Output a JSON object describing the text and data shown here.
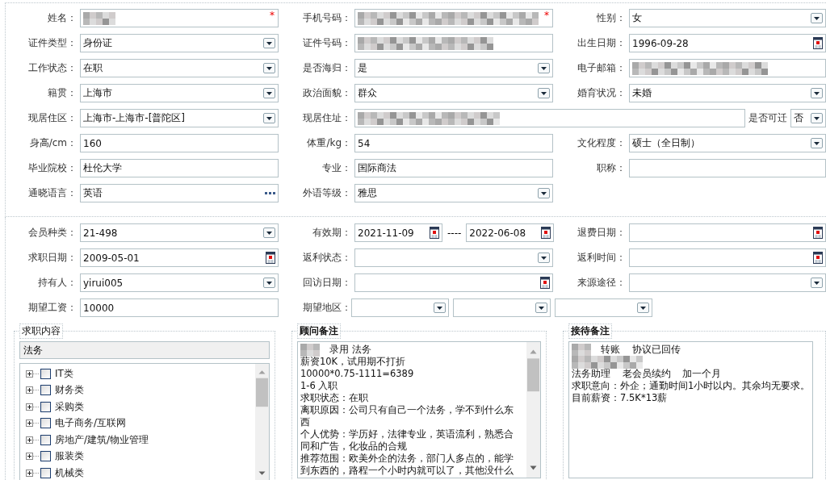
{
  "personal": {
    "rows": [
      {
        "fields": [
          {
            "label": "姓名：",
            "kind": "text",
            "blurred": true,
            "required_mark": "*"
          },
          {
            "label": "手机号码：",
            "kind": "text",
            "blurred": true,
            "required_mark": "*"
          },
          {
            "label": "性别：",
            "kind": "select",
            "value": "女"
          }
        ]
      },
      {
        "fields": [
          {
            "label": "证件类型：",
            "kind": "select",
            "value": "身份证"
          },
          {
            "label": "证件号码：",
            "kind": "text",
            "blurred": true
          },
          {
            "label": "出生日期：",
            "kind": "date",
            "value": "1996-09-28"
          }
        ]
      },
      {
        "fields": [
          {
            "label": "工作状态：",
            "kind": "select",
            "value": "在职"
          },
          {
            "label": "是否海归：",
            "kind": "select",
            "value": "是"
          },
          {
            "label": "电子邮箱：",
            "kind": "text",
            "blurred": true
          }
        ]
      },
      {
        "fields": [
          {
            "label": "籍贯：",
            "kind": "select",
            "value": "上海市"
          },
          {
            "label": "政治面貌：",
            "kind": "select",
            "value": "群众"
          },
          {
            "label": "婚育状况：",
            "kind": "select",
            "value": "未婚"
          }
        ]
      },
      {
        "fields": [
          {
            "label": "现居住区：",
            "kind": "select",
            "value": "上海市-上海市-[普陀区]"
          },
          {
            "label": "现居住址：",
            "kind": "text",
            "blurred": true,
            "suffix": {
              "label": "是否可迁",
              "kind": "select",
              "value": "否"
            }
          }
        ]
      },
      {
        "fields": [
          {
            "label": "身高/cm：",
            "kind": "text",
            "value": "160"
          },
          {
            "label": "体重/kg：",
            "kind": "text",
            "value": "54"
          },
          {
            "label": "文化程度：",
            "kind": "select",
            "value": "硕士（全日制）"
          }
        ]
      },
      {
        "fields": [
          {
            "label": "毕业院校：",
            "kind": "text",
            "value": "杜伦大学"
          },
          {
            "label": "专业：",
            "kind": "text",
            "value": "国际商法"
          },
          {
            "label": "职称：",
            "kind": "text"
          }
        ]
      },
      {
        "fields": [
          {
            "label": "通晓语言：",
            "kind": "lookup",
            "value": "英语"
          },
          {
            "label": "外语等级：",
            "kind": "select",
            "value": "雅思"
          }
        ]
      }
    ]
  },
  "membership": {
    "rows": [
      {
        "fields": [
          {
            "label": "会员种类：",
            "kind": "select",
            "value": "21-498"
          },
          {
            "label": "有效期：",
            "kind": "date_range",
            "from": "2021-11-09",
            "separator": "----",
            "to": "2022-06-08"
          },
          {
            "label": "退费日期：",
            "kind": "date"
          }
        ]
      },
      {
        "fields": [
          {
            "label": "求职日期：",
            "kind": "date",
            "value": "2009-05-01"
          },
          {
            "label": "返利状态：",
            "kind": "select"
          },
          {
            "label": "返利时间：",
            "kind": "date"
          }
        ]
      },
      {
        "fields": [
          {
            "label": "持有人：",
            "kind": "select",
            "value": "yirui005"
          },
          {
            "label": "回访日期：",
            "kind": "date"
          },
          {
            "label": "来源途径：",
            "kind": "select"
          }
        ]
      },
      {
        "fields": [
          {
            "label": "期望工资：",
            "kind": "text",
            "value": "10000"
          },
          {
            "label": "期望地区：",
            "kind": "multi_select",
            "selects": [
              {
                "kind": "select"
              },
              {
                "kind": "select"
              },
              {
                "kind": "select"
              }
            ]
          }
        ]
      }
    ]
  },
  "job_content": {
    "legend": "求职内容",
    "search": {
      "value": "法务"
    },
    "tree": [
      {
        "label": "IT类",
        "expanded": false,
        "checked": false
      },
      {
        "label": "财务类",
        "expanded": false,
        "checked": false
      },
      {
        "label": "采购类",
        "expanded": false,
        "checked": false
      },
      {
        "label": "电子商务/互联网",
        "expanded": false,
        "checked": false
      },
      {
        "label": "房地产/建筑/物业管理",
        "expanded": false,
        "checked": false
      },
      {
        "label": "服装类",
        "expanded": false,
        "checked": false
      },
      {
        "label": "机械类",
        "expanded": false,
        "checked": false
      }
    ]
  },
  "advisor_notes": {
    "legend": "顾问备注",
    "lines": [
      {
        "blurred": true,
        "text": "录用 法务"
      },
      {
        "text": "薪资10K，试用期不打折"
      },
      {
        "text": "10000*0.75-1111=6389"
      },
      {
        "text": "1-6 入职"
      },
      {
        "text": "求职状态：在职"
      },
      {
        "text": "离职原因：公司只有自己一个法务，学不到什么东"
      },
      {
        "text": "西"
      },
      {
        "text": "个人优势：学历好，法律专业，英语流利，熟悉合"
      },
      {
        "text": "同和广告，化妆品的合规"
      },
      {
        "text": "推荐范围：欧美外企的法务，部门人多点的，能学"
      },
      {
        "text": "到东西的，路程一个小时内就可以了，其他没什么"
      }
    ]
  },
  "reception_notes": {
    "legend": "接待备注",
    "lines": [
      {
        "blurred": true,
        "text": "转账    协议已回传"
      },
      {
        "blurred": true
      },
      {
        "text": "法务助理    老会员续约    加一个月"
      },
      {
        "text": "求职意向：外企；通勤时间1小时以内。其余均无要求。"
      },
      {
        "text": "目前薪资：7.5K*13薪"
      }
    ]
  }
}
